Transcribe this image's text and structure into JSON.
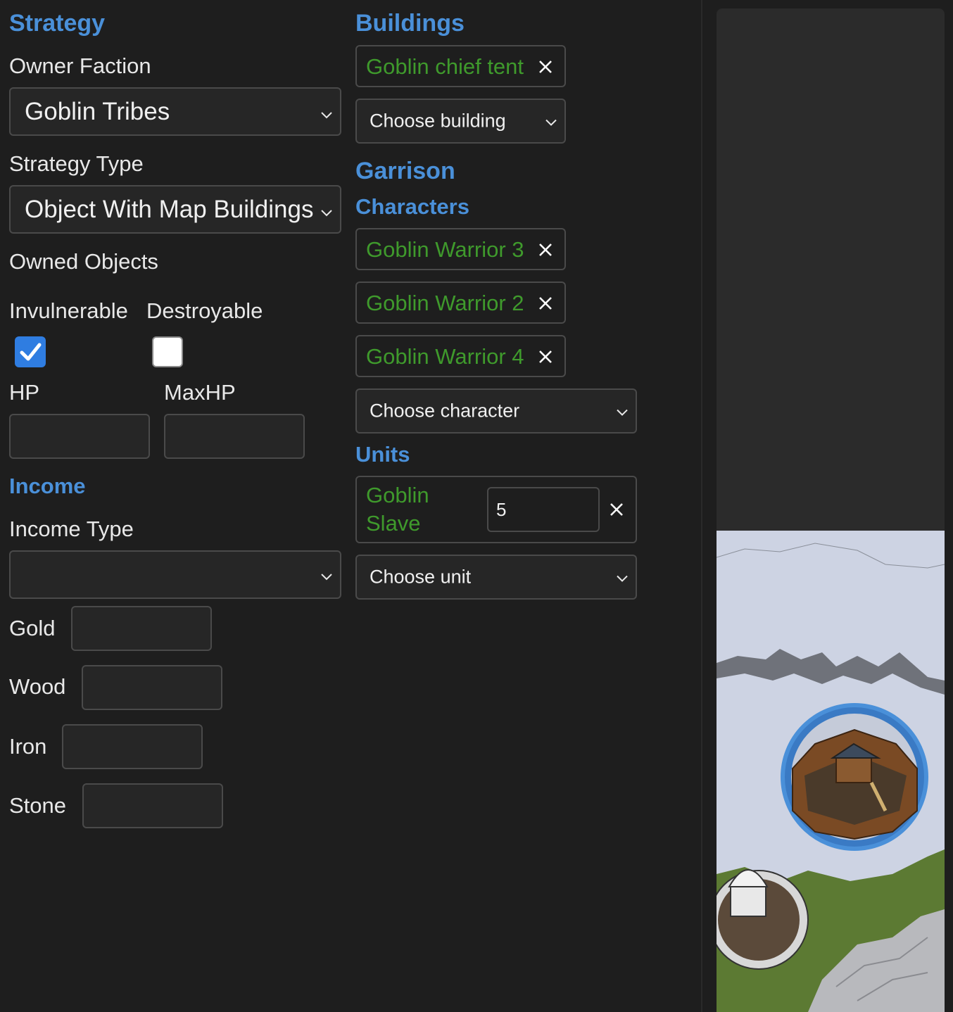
{
  "strategy": {
    "heading": "Strategy",
    "owner_faction": {
      "label": "Owner Faction",
      "value": "Goblin Tribes"
    },
    "strategy_type": {
      "label": "Strategy Type",
      "value": "Object With Map Buildings"
    },
    "owned_objects_label": "Owned Objects",
    "invulnerable": {
      "label": "Invulnerable",
      "checked": true
    },
    "destroyable": {
      "label": "Destroyable",
      "checked": false
    },
    "hp": {
      "label": "HP",
      "value": ""
    },
    "maxhp": {
      "label": "MaxHP",
      "value": ""
    }
  },
  "income": {
    "heading": "Income",
    "type_label": "Income Type",
    "type_value": "",
    "resources": [
      {
        "label": "Gold",
        "value": ""
      },
      {
        "label": "Wood",
        "value": ""
      },
      {
        "label": "Iron",
        "value": ""
      },
      {
        "label": "Stone",
        "value": ""
      }
    ]
  },
  "buildings": {
    "heading": "Buildings",
    "items": [
      {
        "name": "Goblin chief tent"
      }
    ],
    "choose_placeholder": "Choose building"
  },
  "garrison": {
    "heading": "Garrison",
    "characters_heading": "Characters",
    "characters": [
      {
        "name": "Goblin Warrior 3"
      },
      {
        "name": "Goblin Warrior 2"
      },
      {
        "name": "Goblin Warrior 4"
      }
    ],
    "choose_character": "Choose character",
    "units_heading": "Units",
    "units": [
      {
        "name_line1": "Goblin",
        "name_line2": "Slave",
        "count": "5"
      }
    ],
    "choose_unit": "Choose unit"
  },
  "icons": {
    "remove": "close-icon",
    "dropdown": "chevron-down-icon",
    "check": "checkmark-icon"
  },
  "colors": {
    "accent": "#4a90d9",
    "tag_text": "#3f9a2c",
    "checkbox_checked": "#2f7de1",
    "map_ring": "#4a90d9"
  }
}
